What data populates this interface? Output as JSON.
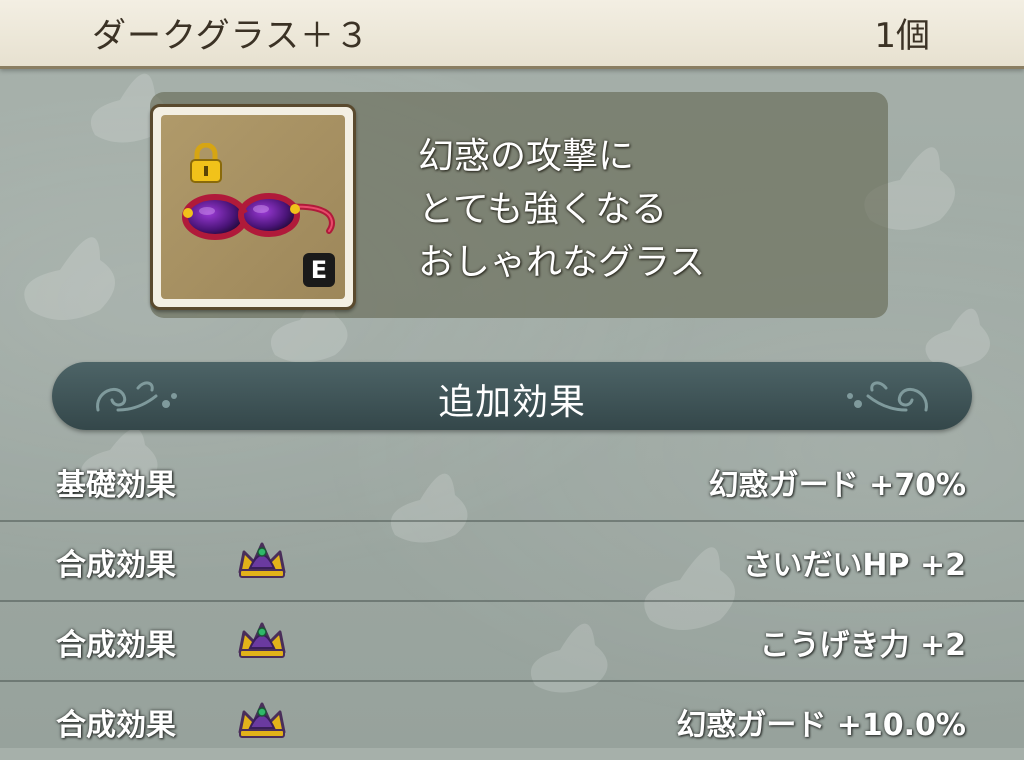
{
  "header": {
    "item_name": "ダークグラス＋３",
    "quantity": "1個"
  },
  "item": {
    "icon": "dark-glasses-icon",
    "locked_icon": "padlock-icon",
    "equipped_badge": "E",
    "description_lines": [
      "幻惑の攻撃に",
      "とても強くなる",
      "おしゃれなグラス"
    ]
  },
  "section": {
    "title": "追加効果"
  },
  "effects": [
    {
      "label": "基礎効果",
      "icon": "",
      "value": "幻惑ガード +70%"
    },
    {
      "label": "合成効果",
      "icon": "crown-icon",
      "value": "さいだいHP +2"
    },
    {
      "label": "合成効果",
      "icon": "crown-icon",
      "value": "こうげき力 +2"
    },
    {
      "label": "合成効果",
      "icon": "crown-icon",
      "value": "幻惑ガード +10.0%"
    }
  ],
  "colors": {
    "header_bg": "#f3efe3",
    "banner_bg": "#3f5558",
    "panel_bg": "#646852",
    "lens_purple": "#5a1a8a",
    "frame_red": "#b01a3a",
    "crown_gold": "#e2b21a"
  }
}
